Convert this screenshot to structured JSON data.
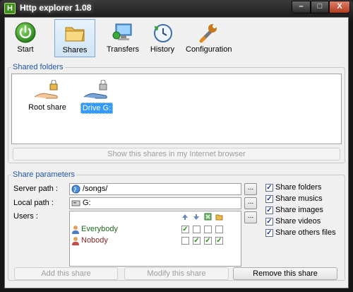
{
  "window": {
    "title": "Http explorer 1.08",
    "app_icon_letter": "H",
    "minimize": "–",
    "maximize": "□",
    "close": "X"
  },
  "toolbar": [
    {
      "label": "Start",
      "icon": "power-icon"
    },
    {
      "label": "Shares",
      "icon": "folder-icon"
    },
    {
      "label": "Transfers",
      "icon": "computer-network-icon"
    },
    {
      "label": "History",
      "icon": "history-icon"
    },
    {
      "label": "Configuration",
      "icon": "wrench-icon"
    }
  ],
  "shared_folders": {
    "title": "Shared folders",
    "items": [
      {
        "label": "Root share",
        "icon": "hand-share-icon",
        "selected": false
      },
      {
        "label": "Drive G:",
        "icon": "hand-share-icon",
        "selected": true
      }
    ],
    "browser_button": "Show this shares in my Internet browser"
  },
  "share_parameters": {
    "title": "Share parameters",
    "server_path_label": "Server path :",
    "server_path_value": "/songs/",
    "local_path_label": "Local path :",
    "local_path_value": "G:",
    "users_label": "Users :",
    "browse_label": "...",
    "permission_icons": [
      "upload-arrow-icon",
      "download-arrow-icon",
      "delete-icon",
      "folder-add-icon"
    ],
    "users": [
      {
        "name": "Everybody",
        "color": "#1f6b1f",
        "perms": [
          true,
          false,
          false,
          false
        ]
      },
      {
        "name": "Nobody",
        "color": "#8a1f1f",
        "perms": [
          false,
          true,
          true,
          true
        ]
      }
    ],
    "options": [
      {
        "label": "Share folders",
        "checked": true
      },
      {
        "label": "Share musics",
        "checked": true
      },
      {
        "label": "Share images",
        "checked": true
      },
      {
        "label": "Share videos",
        "checked": true
      },
      {
        "label": "Share others files",
        "checked": true
      }
    ],
    "add_button": "Add this share",
    "modify_button": "Modify this share",
    "remove_button": "Remove this share"
  },
  "colors": {
    "group_title": "#1e55a8",
    "selection": "#3399ff",
    "check": "#2a8a14"
  }
}
